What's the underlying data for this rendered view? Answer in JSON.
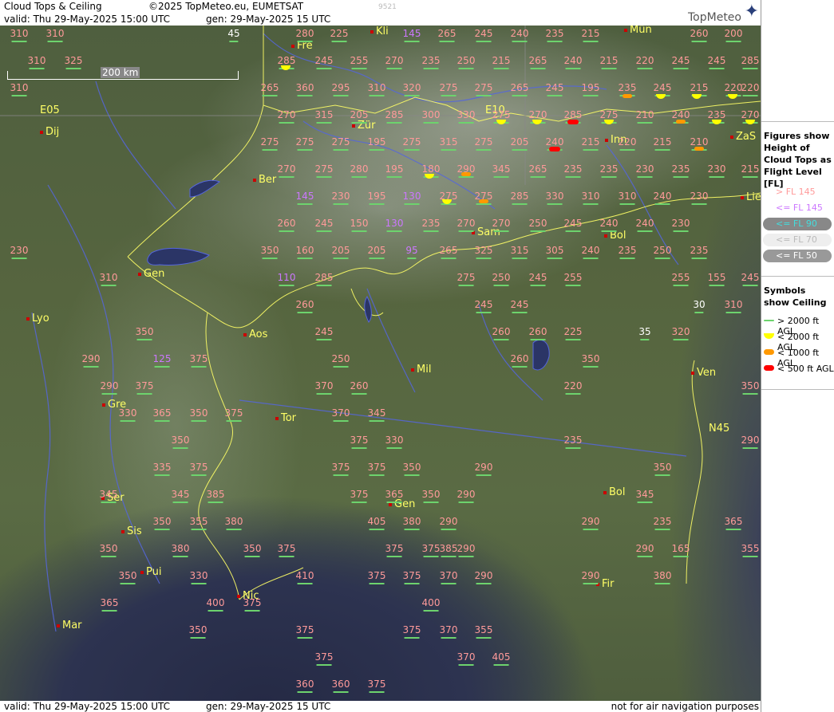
{
  "header": {
    "title": "Cloud Tops & Ceiling",
    "copyright": "©2025 TopMeteo.eu, EUMETSAT",
    "valid": "valid:  Thu  29-May-2025  15:00 UTC",
    "gen": "gen: 29-May-2025 15 UTC",
    "code": "9521",
    "logo": "TopMeteo"
  },
  "footer": {
    "valid": "valid:  Thu  29-May-2025  15:00 UTC",
    "gen": "gen: 29-May-2025 15 UTC",
    "note": "not for air navigation purposes"
  },
  "scale": {
    "label": "200 km"
  },
  "legend": {
    "title1": "Figures show Height of Cloud Tops as Flight Level  [FL]",
    "items1": [
      {
        "label": "> FL 145",
        "color": "#ff9a9a"
      },
      {
        "label": "<= FL 145",
        "color": "#cc77ff"
      },
      {
        "label": "<= FL 90",
        "color": "#44dddd"
      },
      {
        "label": "<= FL 70",
        "color": "#bbbbbb"
      },
      {
        "label": "<= FL 50",
        "color": "#ffffff"
      }
    ],
    "title2": "Symbols show Ceiling",
    "items2": [
      {
        "label": "> 2000 ft AGL",
        "color": "#6dd36d"
      },
      {
        "label": "< 2000 ft AGL",
        "color": "#ffff00"
      },
      {
        "label": "< 1000 ft AGL",
        "color": "#ff9900"
      },
      {
        "label": "< 500 ft AGL",
        "color": "#ff0000"
      }
    ]
  },
  "cities": [
    {
      "name": "Fre"
    },
    {
      "name": "Kli"
    },
    {
      "name": "Mün"
    },
    {
      "name": "Zür"
    },
    {
      "name": "Dij"
    },
    {
      "name": "Ber"
    },
    {
      "name": "Inn"
    },
    {
      "name": "ZaS"
    },
    {
      "name": "Lie"
    },
    {
      "name": "Sam"
    },
    {
      "name": "Bol"
    },
    {
      "name": "Gen"
    },
    {
      "name": "Lyo"
    },
    {
      "name": "Aos"
    },
    {
      "name": "Mil"
    },
    {
      "name": "Ven"
    },
    {
      "name": "Gre"
    },
    {
      "name": "Tor"
    },
    {
      "name": "Ser"
    },
    {
      "name": "Sis"
    },
    {
      "name": "Gen"
    },
    {
      "name": "Bol"
    },
    {
      "name": "Pui"
    },
    {
      "name": "Nic"
    },
    {
      "name": "Mar"
    },
    {
      "name": "Fir"
    },
    {
      "name": "E05"
    },
    {
      "name": "E10"
    },
    {
      "name": "N45"
    }
  ],
  "flight_levels": [
    "310",
    "310",
    "45",
    "280",
    "225",
    "145",
    "265",
    "245",
    "240",
    "235",
    "215",
    "260",
    "200",
    "310",
    "325",
    "285",
    "245",
    "255",
    "270",
    "235",
    "250",
    "215",
    "265",
    "240",
    "215",
    "220",
    "245",
    "245",
    "285",
    "310",
    "265",
    "360",
    "295",
    "310",
    "320",
    "275",
    "275",
    "265",
    "245",
    "195",
    "235",
    "245",
    "215",
    "220",
    "220",
    "270",
    "315",
    "205",
    "285",
    "300",
    "330",
    "275",
    "270",
    "285",
    "275",
    "210",
    "240",
    "235",
    "270",
    "275",
    "275",
    "275",
    "195",
    "275",
    "315",
    "275",
    "205",
    "240",
    "215",
    "220",
    "215",
    "210",
    "270",
    "275",
    "280",
    "195",
    "180",
    "290",
    "345",
    "265",
    "235",
    "235",
    "230",
    "235",
    "230",
    "215",
    "145",
    "230",
    "195",
    "130",
    "275",
    "275",
    "285",
    "330",
    "310",
    "310",
    "240",
    "230",
    "260",
    "245",
    "150",
    "130",
    "235",
    "270",
    "270",
    "250",
    "245",
    "240",
    "240",
    "230",
    "230",
    "350",
    "160",
    "205",
    "205",
    "95",
    "265",
    "325",
    "315",
    "305",
    "240",
    "235",
    "250",
    "235",
    "310",
    "110",
    "285",
    "275",
    "250",
    "245",
    "255",
    "255",
    "155",
    "245",
    "30",
    "260",
    "245",
    "245",
    "310",
    "350",
    "245",
    "260",
    "260",
    "225",
    "35",
    "320",
    "290",
    "125",
    "375",
    "250",
    "260",
    "350",
    "290",
    "375",
    "370",
    "260",
    "220",
    "350",
    "330",
    "365",
    "350",
    "375",
    "370",
    "345",
    "350",
    "375",
    "330",
    "235",
    "290",
    "335",
    "375",
    "375",
    "375",
    "350",
    "290",
    "350",
    "345",
    "345",
    "385",
    "375",
    "365",
    "350",
    "290",
    "345",
    "350",
    "355",
    "380",
    "405",
    "380",
    "290",
    "290",
    "235",
    "365",
    "350",
    "380",
    "350",
    "375",
    "375",
    "375",
    "385",
    "290",
    "290",
    "165",
    "355",
    "350",
    "330",
    "410",
    "375",
    "375",
    "370",
    "290",
    "290",
    "380",
    "365",
    "400",
    "375",
    "400",
    "350",
    "375",
    "375",
    "370",
    "355",
    "375",
    "370",
    "405",
    "360",
    "360",
    "375"
  ]
}
